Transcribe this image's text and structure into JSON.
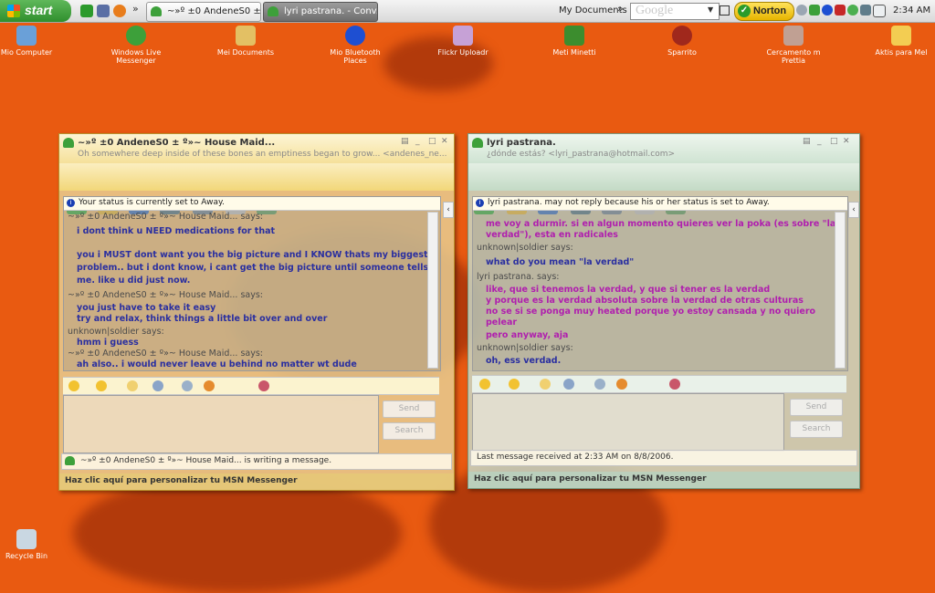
{
  "taskbar": {
    "start_label": "start",
    "tasks": [
      {
        "label": "~»º ±0 AndeneS0 ± ~...",
        "active": false
      },
      {
        "label": "lyri pastrana. - Conv...",
        "active": true
      }
    ],
    "my_documents": "My Documents",
    "google_placeholder": "Google",
    "norton_label": "Norton",
    "clock": "2:34 AM"
  },
  "desktop_icons": [
    {
      "label": "Mio Computer"
    },
    {
      "label": "Windows Live Messenger"
    },
    {
      "label": "Mei Documents"
    },
    {
      "label": "Mio Bluetooth Places"
    },
    {
      "label": "Flickr Uploadr"
    },
    {
      "label": "Meti Minetti"
    },
    {
      "label": "Sparrito"
    },
    {
      "label": "Cercamento m Prettia"
    },
    {
      "label": "Aktis para Mel"
    },
    {
      "label": "Recycle Bin"
    }
  ],
  "left_window": {
    "title": "~»º ±0 AndeneS0 ± º»~ House Maid...",
    "subtitle": "Oh somewhere deep inside of these bones an emptiness began to grow... <andenes_ne...",
    "notice": "Your status is currently set to Away.",
    "messages": [
      {
        "kind": "who",
        "text": "~»º ±0 AndeneS0 ± º»~ House Maid... says:"
      },
      {
        "kind": "msg",
        "text": "i dont think u NEED medications for that"
      },
      {
        "kind": "msg",
        "text": "you i MUST dont want you the big picture and I KNOW thats my biggest"
      },
      {
        "kind": "msg",
        "text": "problem.. but i dont know, i cant get the big picture until someone tells"
      },
      {
        "kind": "msg",
        "text": "me. like u did just now."
      },
      {
        "kind": "who",
        "text": "~»º ±0 AndeneS0 ± º»~ House Maid... says:"
      },
      {
        "kind": "msg",
        "text": "you just have to take it easy"
      },
      {
        "kind": "msg",
        "text": "try and relax, think things a little bit over and over"
      },
      {
        "kind": "who",
        "text": "unknown|soldier says:"
      },
      {
        "kind": "msg",
        "text": "hmm i guess"
      },
      {
        "kind": "who",
        "text": "~»º ±0 AndeneS0 ± º»~ House Maid... says:"
      },
      {
        "kind": "msg",
        "text": "ah also.. i would never leave u behind no matter wt dude"
      }
    ],
    "send_label": "Send",
    "search_label": "Search",
    "status_text": "~»º ±0 AndeneS0 ± º»~ House Maid... is writing a message.",
    "footer": "Haz clic aquí para personalizar tu MSN Messenger"
  },
  "right_window": {
    "title": "lyri pastrana.",
    "subtitle": "¿dónde estás? <lyri_pastrana@hotmail.com>",
    "notice": "lyri pastrana. may not reply because his or her status is set to Away.",
    "messages": [
      {
        "kind": "pink",
        "text": "me voy a durmir. si en algun momento quieres ver la poka (es sobre \"la"
      },
      {
        "kind": "pink",
        "text": "verdad\"), esta en radicales"
      },
      {
        "kind": "who",
        "text": "unknown|soldier says:"
      },
      {
        "kind": "blue",
        "text": "what do you mean \"la verdad\""
      },
      {
        "kind": "who",
        "text": "lyri pastrana. says:"
      },
      {
        "kind": "pink",
        "text": "like, que si tenemos la verdad, y que si tener es la verdad"
      },
      {
        "kind": "pink",
        "text": "y porque es la verdad absoluta sobre la verdad de otras culturas"
      },
      {
        "kind": "pink",
        "text": "no se si se ponga muy heated porque yo estoy cansada y no quiero"
      },
      {
        "kind": "pink",
        "text": "pelear"
      },
      {
        "kind": "pink",
        "text": "pero anyway, aja"
      },
      {
        "kind": "who",
        "text": "unknown|soldier says:"
      },
      {
        "kind": "blue",
        "text": "oh, ess verdad."
      }
    ],
    "send_label": "Send",
    "search_label": "Search",
    "status_text": "Last message received at 2:33 AM on 8/8/2006.",
    "footer": "Haz clic aquí para personalizar tu MSN Messenger"
  },
  "colors": {
    "desktop_bg": "#e95a11",
    "sender_blue": "#2a2fa0",
    "sender_pink": "#b01fae"
  }
}
